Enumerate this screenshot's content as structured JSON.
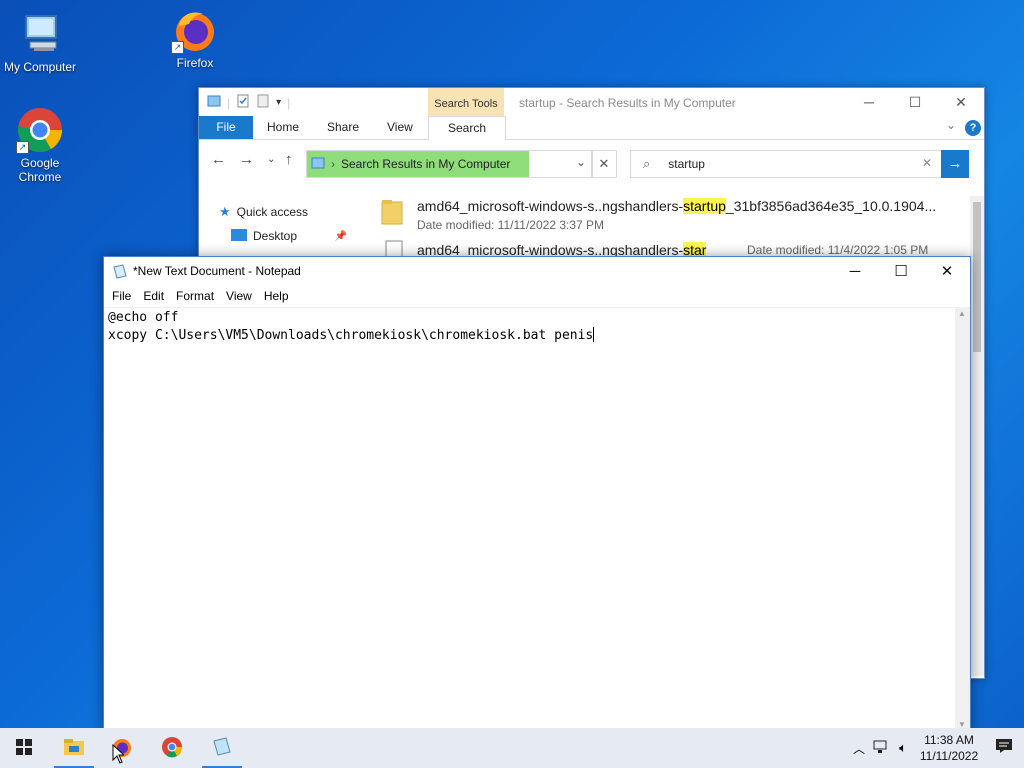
{
  "desktop": {
    "icons": [
      {
        "label": "My Computer"
      },
      {
        "label": "Firefox"
      },
      {
        "label": "Google Chrome"
      }
    ]
  },
  "explorer": {
    "title": "startup - Search Results in My Computer",
    "contextual_tab": "Search Tools",
    "ribbon_tabs": [
      "File",
      "Home",
      "Share",
      "View",
      "Search"
    ],
    "address": "Search Results in My Computer",
    "search_value": "startup",
    "nav_pane": [
      "Quick access",
      "Desktop"
    ],
    "results": [
      {
        "name_prefix": "amd64_microsoft-windows-s..ngshandlers-",
        "name_highlight": "startup",
        "name_suffix": "_31bf3856ad364e35_10.0.1904...",
        "meta_label": "Date modified:",
        "meta_value": "11/11/2022 3:37 PM"
      },
      {
        "name_prefix": "amd64_microsoft-windows-s..ngshandlers-",
        "name_highlight": "star",
        "name_suffix": "",
        "meta_label": "Date modified:",
        "meta_value": "11/4/2022 1:05 PM"
      }
    ]
  },
  "notepad": {
    "title": "*New Text Document - Notepad",
    "menu": [
      "File",
      "Edit",
      "Format",
      "View",
      "Help"
    ],
    "lines": [
      "@echo off",
      "xcopy C:\\Users\\VM5\\Downloads\\chromekiosk\\chromekiosk.bat penis"
    ]
  },
  "taskbar": {
    "time": "11:38 AM",
    "date": "11/11/2022"
  }
}
